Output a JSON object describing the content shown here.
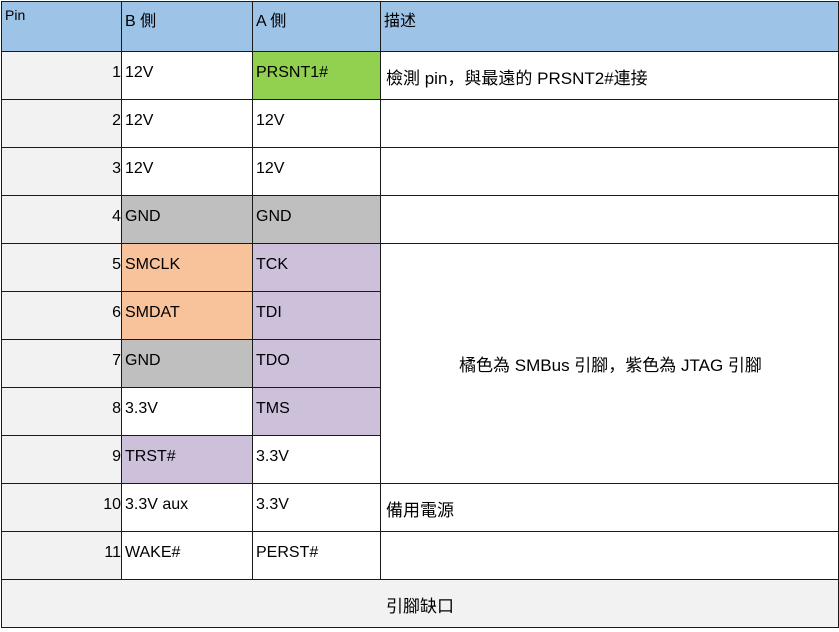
{
  "headers": {
    "pin": "Pin",
    "b_side": "B 側",
    "a_side": "A 側",
    "desc": "描述"
  },
  "rows": [
    {
      "pin": "1",
      "b": "12V",
      "a": "PRSNT1#",
      "b_color": "#ffffff",
      "a_color": "#92d050",
      "desc": "檢測 pin，與最遠的 PRSNT2#連接"
    },
    {
      "pin": "2",
      "b": "12V",
      "a": "12V",
      "b_color": "#ffffff",
      "a_color": "#ffffff",
      "desc": ""
    },
    {
      "pin": "3",
      "b": "12V",
      "a": "12V",
      "b_color": "#ffffff",
      "a_color": "#ffffff",
      "desc": ""
    },
    {
      "pin": "4",
      "b": "GND",
      "a": "GND",
      "b_color": "#bfbfbf",
      "a_color": "#bfbfbf",
      "desc": ""
    },
    {
      "pin": "5",
      "b": "SMCLK",
      "a": "TCK",
      "b_color": "#f8c39b",
      "a_color": "#ccc0da"
    },
    {
      "pin": "6",
      "b": "SMDAT",
      "a": "TDI",
      "b_color": "#f8c39b",
      "a_color": "#ccc0da"
    },
    {
      "pin": "7",
      "b": "GND",
      "a": "TDO",
      "b_color": "#bfbfbf",
      "a_color": "#ccc0da"
    },
    {
      "pin": "8",
      "b": "3.3V",
      "a": "TMS",
      "b_color": "#ffffff",
      "a_color": "#ccc0da"
    },
    {
      "pin": "9",
      "b": "TRST#",
      "a": "3.3V",
      "b_color": "#ccc0da",
      "a_color": "#ffffff"
    },
    {
      "pin": "10",
      "b": "3.3V aux",
      "a": "3.3V",
      "b_color": "#ffffff",
      "a_color": "#ffffff",
      "desc": "備用電源"
    },
    {
      "pin": "11",
      "b": "WAKE#",
      "a": "PERST#",
      "b_color": "#ffffff",
      "a_color": "#ffffff",
      "desc": ""
    }
  ],
  "merged_desc": "橘色為 SMBus 引腳，紫色為 JTAG 引腳",
  "notch_label": "引腳缺口",
  "colors": {
    "header": "#9dc3e6",
    "pin_cell": "#f2f2f2"
  }
}
